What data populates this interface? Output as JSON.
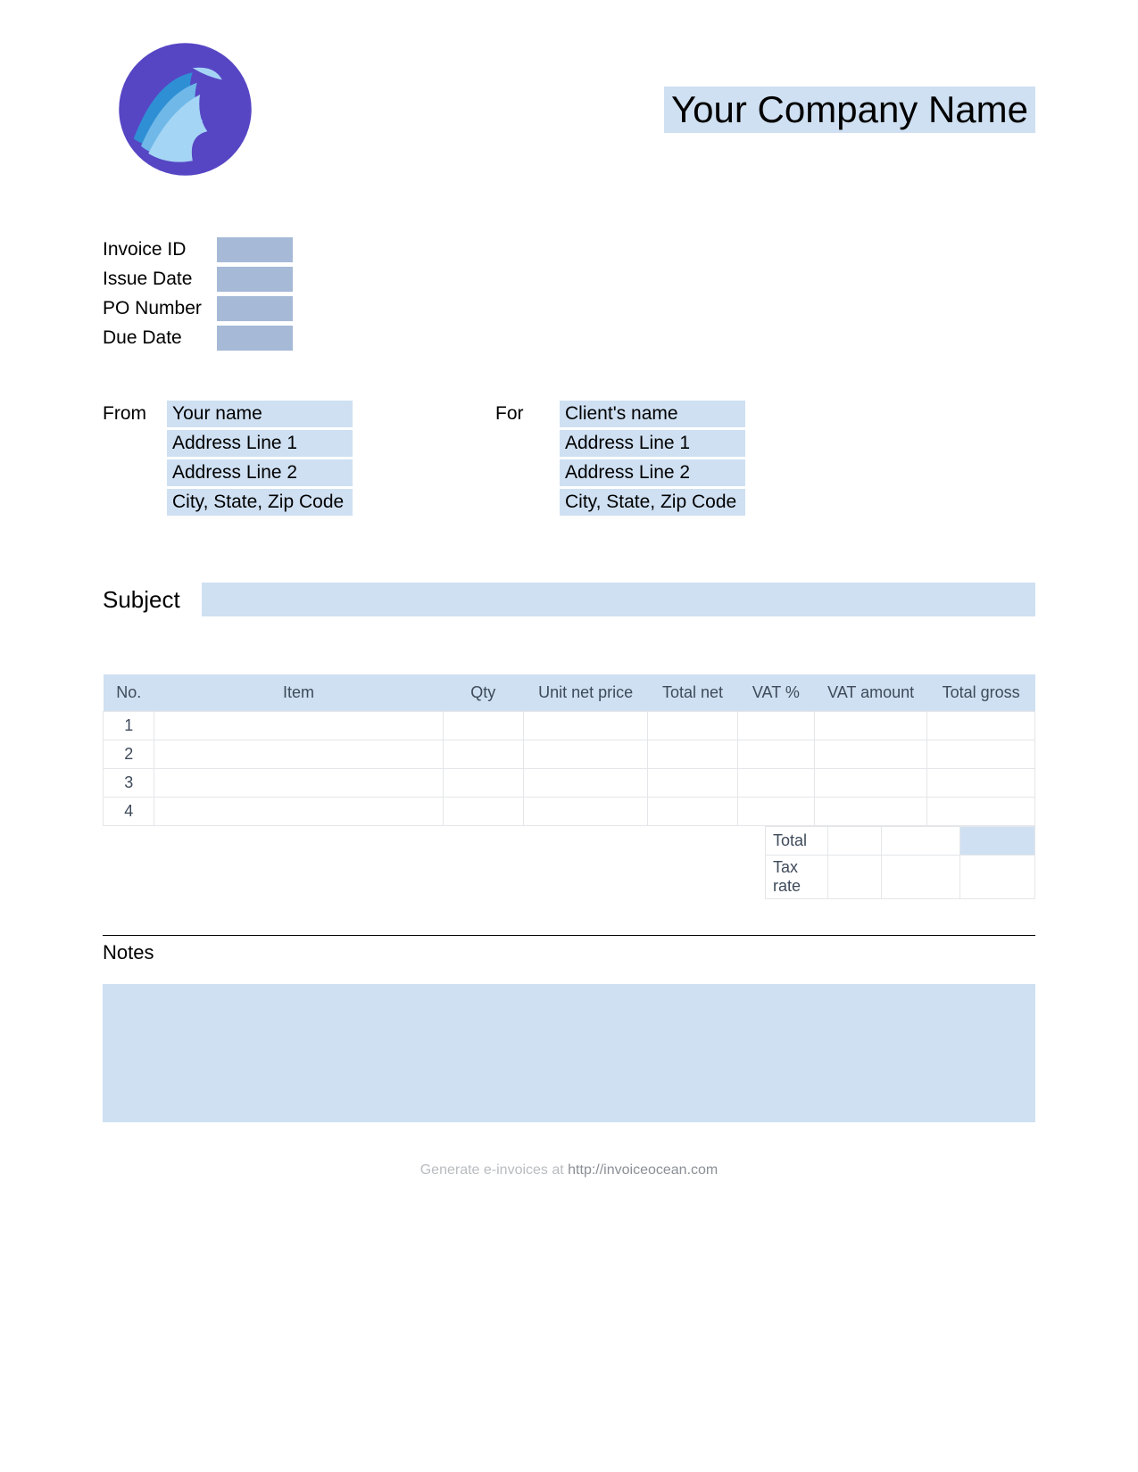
{
  "header": {
    "company_name": "Your Company Name"
  },
  "meta": {
    "invoice_id_label": "Invoice ID",
    "issue_date_label": "Issue Date",
    "po_number_label": "PO Number",
    "due_date_label": "Due Date"
  },
  "from": {
    "label": "From",
    "name": "Your name",
    "addr1": "Address Line 1",
    "addr2": "Address Line 2",
    "city": "City, State, Zip Code"
  },
  "for": {
    "label": "For",
    "name": "Client's name",
    "addr1": "Address Line 1",
    "addr2": "Address Line 2",
    "city": "City, State, Zip Code"
  },
  "subject": {
    "label": "Subject"
  },
  "table": {
    "headers": {
      "no": "No.",
      "item": "Item",
      "qty": "Qty",
      "unit": "Unit net price",
      "totalnet": "Total net",
      "vatp": "VAT %",
      "vatamt": "VAT amount",
      "gross": "Total gross"
    },
    "rows": [
      "1",
      "2",
      "3",
      "4"
    ]
  },
  "totals": {
    "total_label": "Total",
    "tax_rate_label": "Tax rate"
  },
  "notes": {
    "label": "Notes"
  },
  "footer": {
    "text": "Generate e-invoices at ",
    "link": "http://invoiceocean.com"
  }
}
